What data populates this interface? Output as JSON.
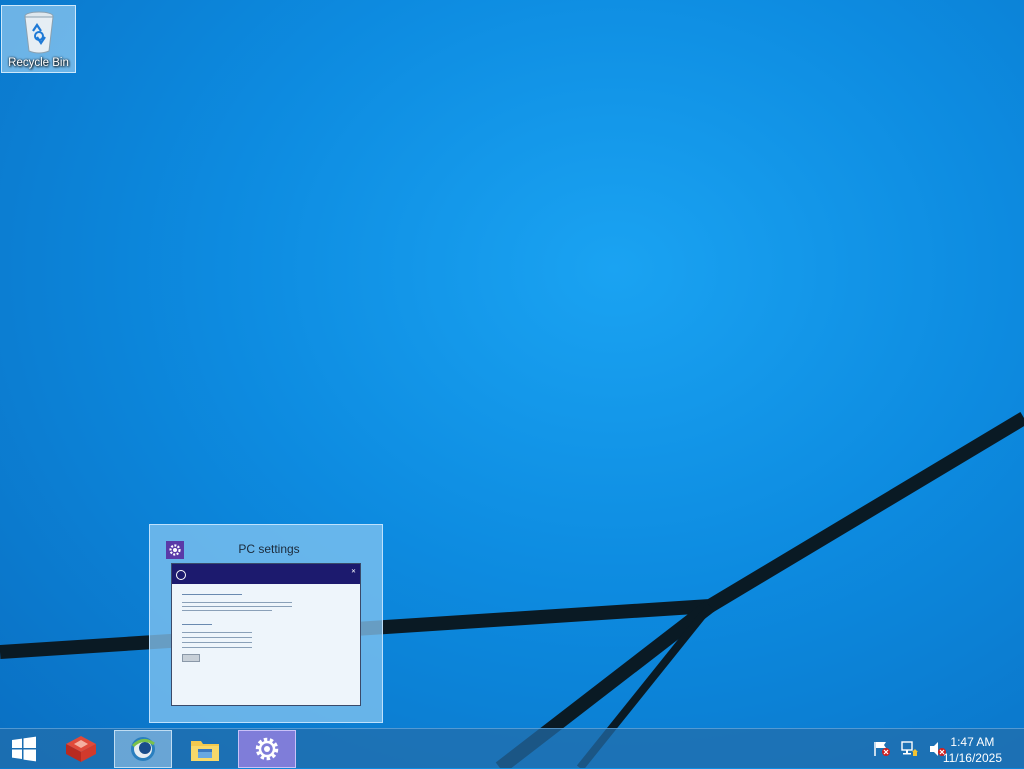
{
  "desktop": {
    "icons": [
      {
        "label": "Recycle Bin",
        "icon": "recycle-bin-icon"
      }
    ]
  },
  "thumbnail": {
    "title": "PC settings",
    "icon": "gear-icon",
    "accent": "#5a3aa8"
  },
  "taskbar": {
    "start_icon": "windows-logo-icon",
    "apps": [
      {
        "name": "rhino-app",
        "icon": "red-cube-icon"
      },
      {
        "name": "browser",
        "icon": "browser-globe-icon"
      },
      {
        "name": "file-explorer",
        "icon": "folder-icon"
      },
      {
        "name": "pc-settings",
        "icon": "gear-icon"
      }
    ],
    "tray_icons": [
      "action-center-flag-icon",
      "network-icon",
      "speaker-muted-icon"
    ],
    "clock": {
      "time": "1:47 AM",
      "date": "11/16/2025"
    }
  }
}
